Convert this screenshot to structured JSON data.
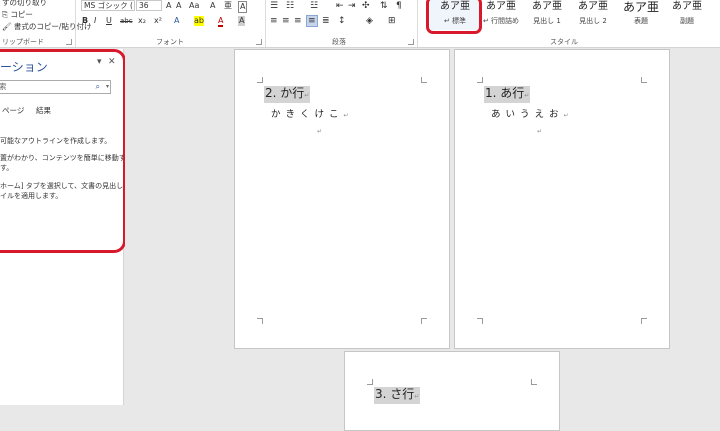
{
  "ribbon": {
    "clipboard": {
      "items": [
        "すの切り取り",
        "コピー",
        "書式のコピー/貼り付け"
      ],
      "label": "リップボード"
    },
    "font": {
      "name": "MS ゴシック (",
      "size": "36",
      "grow": "A",
      "shrink": "A",
      "case": "Aa",
      "clear": "A",
      "phonetic": "亜",
      "ruby": "A",
      "bold": "B",
      "italic": "I",
      "underline": "U",
      "strike": "abc",
      "subscript": "x₂",
      "superscript": "x²",
      "effects": "A",
      "highlight": "ab",
      "color": "A",
      "border_char": "A",
      "label": "フォント"
    },
    "paragraph": {
      "label": "段落"
    },
    "styles": {
      "label": "スタイル",
      "items": [
        {
          "sample": "あア亜",
          "name": "↵ 標準"
        },
        {
          "sample": "あア亜",
          "name": "↵ 行間詰め"
        },
        {
          "sample": "あア亜",
          "name": "見出し 1"
        },
        {
          "sample": "あア亜",
          "name": "見出し 2"
        },
        {
          "sample": "あア亜",
          "name": "表題"
        },
        {
          "sample": "あア亜",
          "name": "副題"
        }
      ]
    }
  },
  "nav": {
    "title": "ーション",
    "search_value": "索",
    "tabs": [
      "ページ",
      "結果"
    ],
    "lines": [
      "可能なアウトラインを作成します。",
      "",
      "置がわかり、コンテンツを簡単に移動する",
      "す。",
      "",
      "ホーム] タブを選択して、文書の見出しに",
      "イルを適用します。"
    ]
  },
  "doc": {
    "pages": [
      {
        "heading": "2. か行",
        "body": "かきくけこ"
      },
      {
        "heading": "1. あ行",
        "body": "あいうえお"
      },
      {
        "heading": "3. さ行",
        "body": ""
      }
    ],
    "return_mark": "↵"
  },
  "colors": {
    "accent": "#2b579a",
    "highlight_outline": "#d8192b",
    "heading_bg": "#d4d4d4"
  }
}
